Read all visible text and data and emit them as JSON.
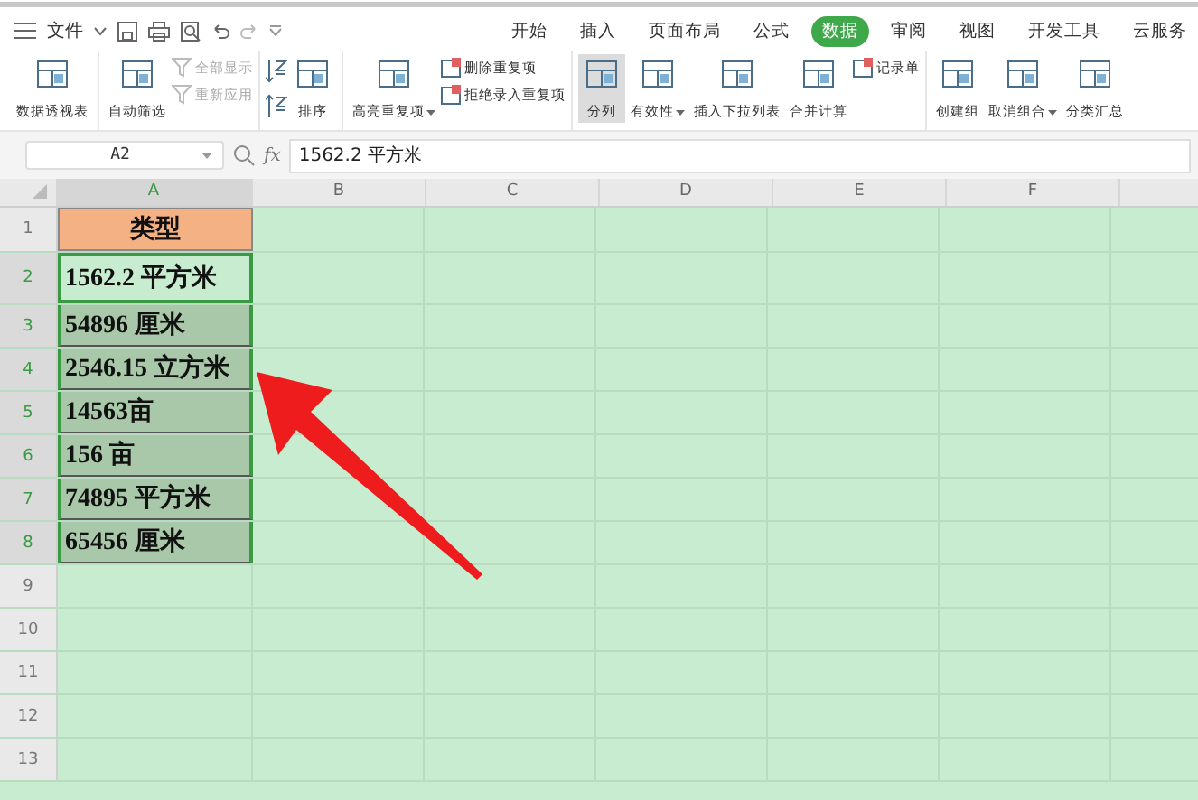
{
  "quick_access": {
    "menu_label": "文件"
  },
  "tabs": [
    {
      "label": "开始",
      "selected": false
    },
    {
      "label": "插入",
      "selected": false
    },
    {
      "label": "页面布局",
      "selected": false
    },
    {
      "label": "公式",
      "selected": false
    },
    {
      "label": "数据",
      "selected": true
    },
    {
      "label": "审阅",
      "selected": false
    },
    {
      "label": "视图",
      "selected": false
    },
    {
      "label": "开发工具",
      "selected": false
    },
    {
      "label": "云服务",
      "selected": false
    }
  ],
  "ribbon_groups": [
    {
      "items": [
        {
          "kind": "large",
          "label": "数据透视表",
          "dropdown": false,
          "selected": false
        }
      ]
    },
    {
      "items": [
        {
          "kind": "large",
          "label": "自动筛选",
          "dropdown": false,
          "selected": false
        },
        {
          "kind": "stack",
          "entries": [
            {
              "label": "全部显示",
              "disabled": true
            },
            {
              "label": "重新应用",
              "disabled": true
            }
          ]
        }
      ]
    },
    {
      "items": [
        {
          "kind": "sort_icons"
        },
        {
          "kind": "large",
          "label": "排序",
          "dropdown": false,
          "selected": false
        }
      ]
    },
    {
      "items": [
        {
          "kind": "large",
          "label": "高亮重复项",
          "dropdown": true,
          "selected": false
        },
        {
          "kind": "stack",
          "entries": [
            {
              "label": "删除重复项",
              "disabled": false
            },
            {
              "label": "拒绝录入重复项",
              "disabled": false
            }
          ]
        }
      ]
    },
    {
      "items": [
        {
          "kind": "large",
          "label": "分列",
          "dropdown": false,
          "selected": true
        },
        {
          "kind": "large",
          "label": "有效性",
          "dropdown": true,
          "selected": false
        },
        {
          "kind": "large",
          "label": "插入下拉列表",
          "dropdown": false,
          "selected": false
        },
        {
          "kind": "large",
          "label": "合并计算",
          "dropdown": false,
          "selected": false
        },
        {
          "kind": "stack",
          "entries": [
            {
              "label": "记录单",
              "disabled": false
            }
          ]
        }
      ]
    },
    {
      "items": [
        {
          "kind": "large",
          "label": "创建组",
          "dropdown": false,
          "selected": false
        },
        {
          "kind": "large",
          "label": "取消组合",
          "dropdown": true,
          "selected": false
        },
        {
          "kind": "large",
          "label": "分类汇总",
          "dropdown": false,
          "selected": false
        }
      ]
    }
  ],
  "formula_bar": {
    "name_box": "A2",
    "function_label": "fx",
    "formula": "1562.2 平方米"
  },
  "sheet": {
    "columns": [
      {
        "label": "A",
        "selected": true
      },
      {
        "label": "B",
        "selected": false
      },
      {
        "label": "C",
        "selected": false
      },
      {
        "label": "D",
        "selected": false
      },
      {
        "label": "E",
        "selected": false
      },
      {
        "label": "F",
        "selected": false
      }
    ],
    "rows": [
      {
        "label": "1",
        "selected": false,
        "cells": [
          {
            "text": "类型",
            "kind": "header",
            "selected": false,
            "active": false
          }
        ]
      },
      {
        "label": "2",
        "selected": true,
        "cells": [
          {
            "text": "1562.2 平方米",
            "kind": "data",
            "selected": true,
            "active": true
          }
        ]
      },
      {
        "label": "3",
        "selected": true,
        "cells": [
          {
            "text": "54896 厘米",
            "kind": "data",
            "selected": true,
            "active": false
          }
        ]
      },
      {
        "label": "4",
        "selected": true,
        "cells": [
          {
            "text": "2546.15 立方米",
            "kind": "data",
            "selected": true,
            "active": false
          }
        ]
      },
      {
        "label": "5",
        "selected": true,
        "cells": [
          {
            "text": "14563亩",
            "kind": "data",
            "selected": true,
            "active": false
          }
        ]
      },
      {
        "label": "6",
        "selected": true,
        "cells": [
          {
            "text": "156 亩",
            "kind": "data",
            "selected": true,
            "active": false
          }
        ]
      },
      {
        "label": "7",
        "selected": true,
        "cells": [
          {
            "text": "74895 平方米",
            "kind": "data",
            "selected": true,
            "active": false
          }
        ]
      },
      {
        "label": "8",
        "selected": true,
        "cells": [
          {
            "text": "65456 厘米",
            "kind": "data",
            "selected": true,
            "active": false
          }
        ]
      },
      {
        "label": "9",
        "selected": false,
        "cells": []
      },
      {
        "label": "10",
        "selected": false,
        "cells": []
      },
      {
        "label": "11",
        "selected": false,
        "cells": []
      },
      {
        "label": "12",
        "selected": false,
        "cells": []
      },
      {
        "label": "13",
        "selected": false,
        "cells": []
      }
    ]
  }
}
